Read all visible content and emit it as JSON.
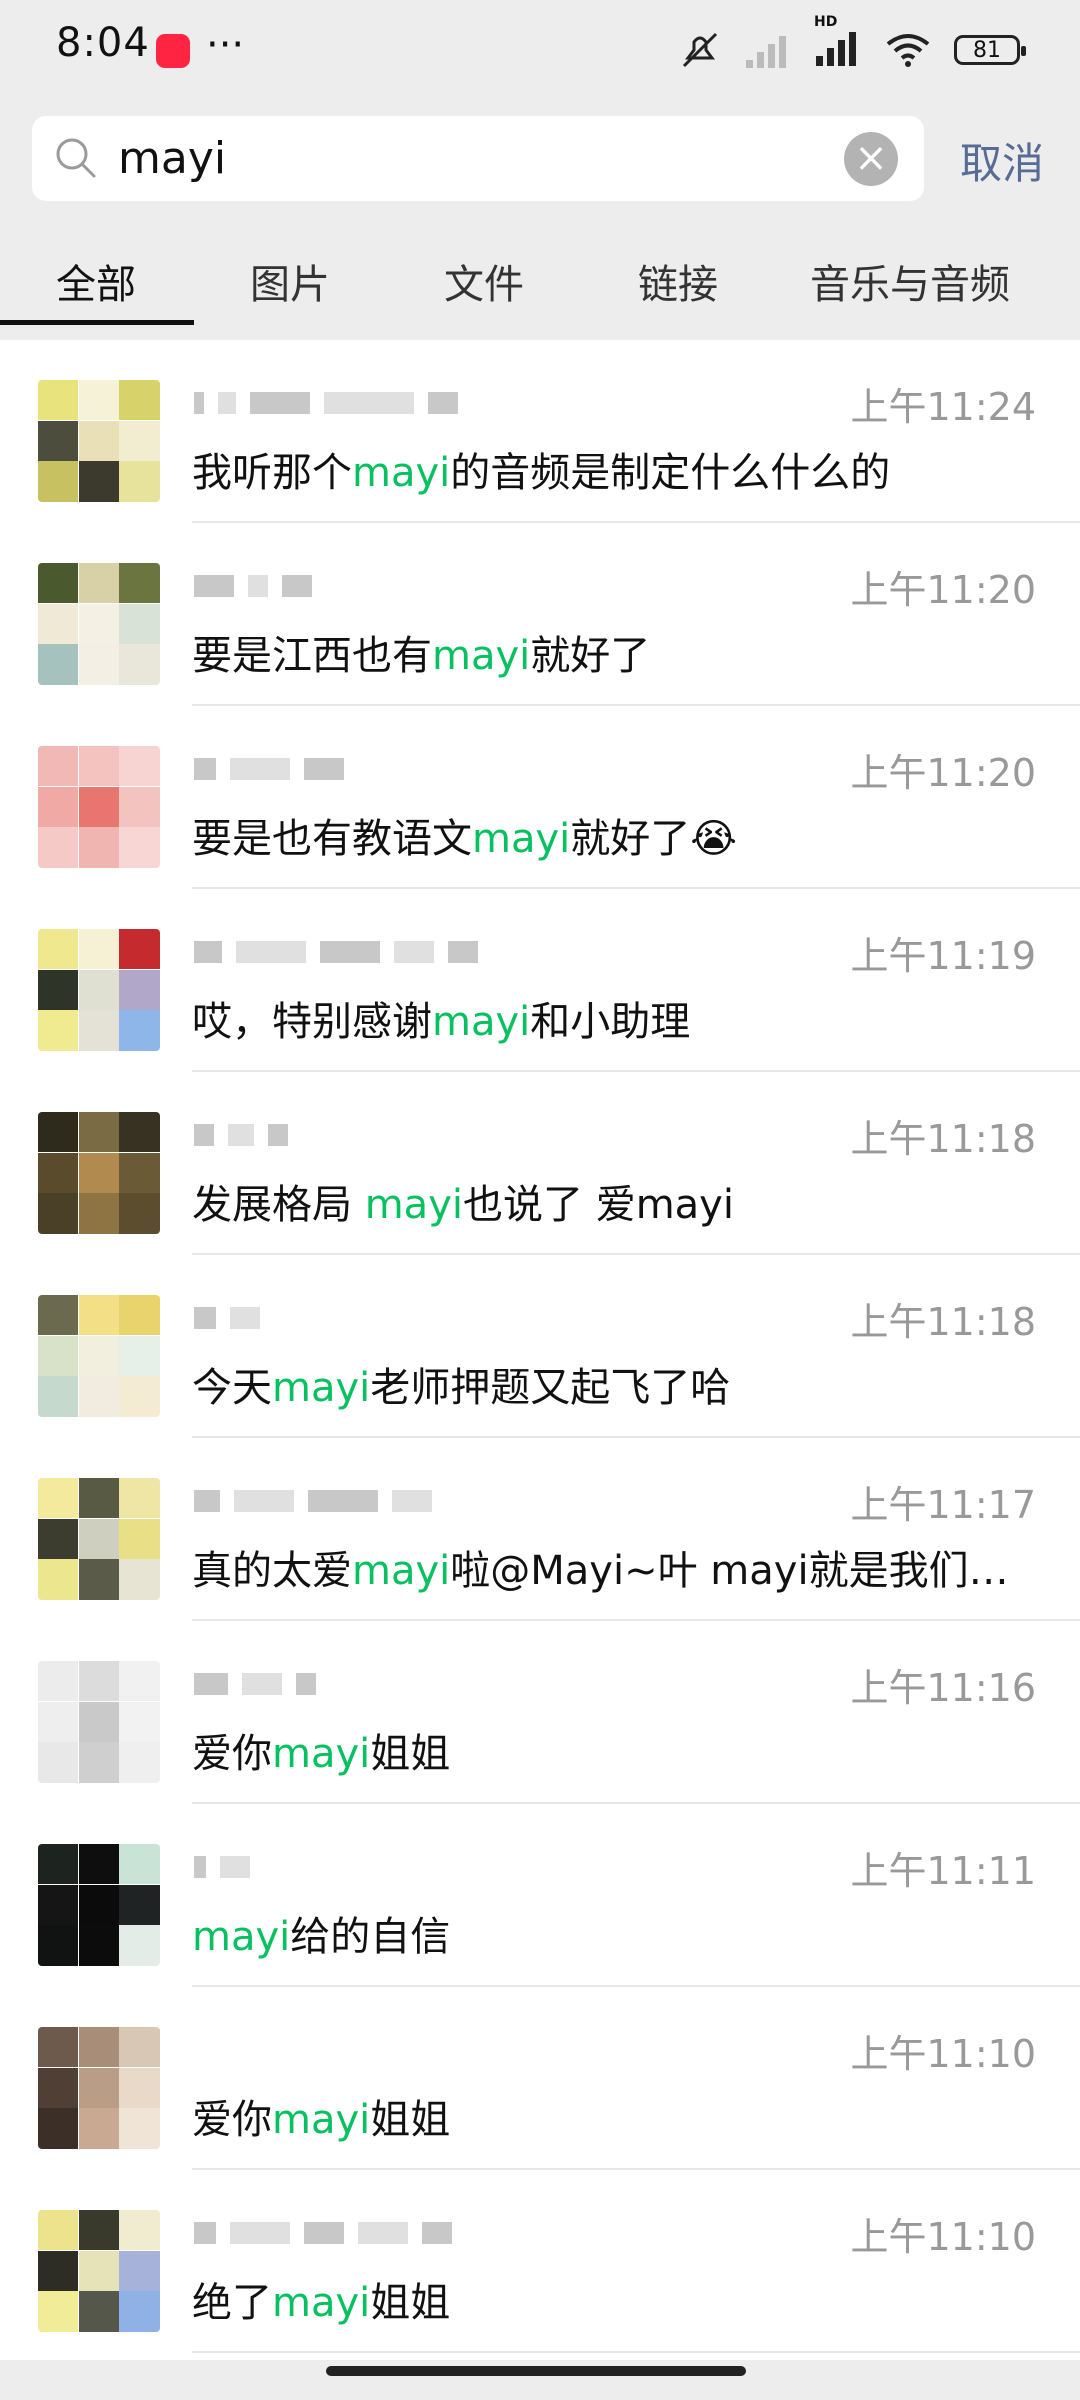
{
  "status_bar": {
    "time": "8:04",
    "notification_app_label": "小红书",
    "more": "···",
    "battery": "81",
    "network": "HD"
  },
  "search": {
    "query": "mayi",
    "cancel_label": "取消"
  },
  "tabs": [
    {
      "label": "全部",
      "active": true
    },
    {
      "label": "图片",
      "active": false
    },
    {
      "label": "文件",
      "active": false
    },
    {
      "label": "链接",
      "active": false
    },
    {
      "label": "音乐与音频",
      "active": false
    }
  ],
  "results": [
    {
      "time": "上午11:24",
      "parts": [
        "我听那个",
        "mayi",
        "的音频是制定什么什么的"
      ],
      "avatar": [
        "#e9e37e",
        "#f6f2d8",
        "#d8d26b",
        "#4d4d3e",
        "#e9e0b8",
        "#f2ecd0",
        "#c7c162",
        "#3b3a2c",
        "#e8e39c"
      ]
    },
    {
      "time": "上午11:20",
      "parts": [
        "要是江西也有",
        "mayi",
        "就好了"
      ],
      "avatar": [
        "#4b5a2e",
        "#d8d1a7",
        "#6a7540",
        "#efe9d6",
        "#f4f1e4",
        "#d9e2d6",
        "#a6c2bf",
        "#f3efe5",
        "#e9e6da"
      ]
    },
    {
      "time": "上午11:20",
      "parts": [
        "要是也有教语文",
        "mayi",
        "就好了😭"
      ],
      "avatar": [
        "#f2b8b5",
        "#f4c2bf",
        "#f7d3d1",
        "#f0a9a4",
        "#e9766e",
        "#f3c3c0",
        "#f5c9c6",
        "#f1b5b1",
        "#f8d6d4"
      ]
    },
    {
      "time": "上午11:19",
      "parts": [
        "哎，特别感谢",
        "mayi",
        "和小助理"
      ],
      "avatar": [
        "#f0e88e",
        "#f6f1d4",
        "#c42a2e",
        "#2f3428",
        "#dfe0d2",
        "#b0a7c9",
        "#f0ea90",
        "#e4e2d6",
        "#8fb6e8"
      ]
    },
    {
      "time": "上午11:18",
      "parts": [
        "发展格局 ",
        "mayi",
        "也说了 爱mayi"
      ],
      "avatar": [
        "#2e2a1c",
        "#7b6b45",
        "#383222",
        "#5a4b2d",
        "#b08a4e",
        "#6b5a36",
        "#4a3f27",
        "#8e7443",
        "#5c4d2e"
      ]
    },
    {
      "time": "上午11:18",
      "parts": [
        "今天",
        "mayi",
        "老师押题又起飞了哈"
      ],
      "avatar": [
        "#6b6a4e",
        "#f2df86",
        "#e9d36c",
        "#d8e2c8",
        "#f3efdf",
        "#e6f0e8",
        "#c6d9cd",
        "#f1ebe0",
        "#f4ecd2"
      ]
    },
    {
      "time": "上午11:17",
      "parts": [
        "真的太爱",
        "mayi",
        "啦@Mayi~叶 mayi就是我们…"
      ],
      "avatar": [
        "#f3ea9e",
        "#595a44",
        "#efe6a5",
        "#3d3d2f",
        "#cfcfbf",
        "#e9df86",
        "#ece68f",
        "#5a5b48",
        "#e7e4d4"
      ]
    },
    {
      "time": "上午11:16",
      "parts": [
        "爱你",
        "mayi",
        "姐姐"
      ],
      "avatar": [
        "#ececec",
        "#dcdcdc",
        "#f1f1f1",
        "#eeeeee",
        "#c9c9c9",
        "#f2f2f2",
        "#e8e8e8",
        "#cfcfcf",
        "#efefef"
      ]
    },
    {
      "time": "上午11:11",
      "parts": [
        "",
        "mayi",
        "给的自信"
      ],
      "avatar": [
        "#1d2420",
        "#0e0e0e",
        "#c9e3d7",
        "#151515",
        "#0b0b0b",
        "#202323",
        "#101312",
        "#0c0c0c",
        "#e4ece8"
      ]
    },
    {
      "time": "上午11:10",
      "parts": [
        "爱你",
        "mayi",
        "姐姐"
      ],
      "avatar": [
        "#6e5a4c",
        "#a88d79",
        "#d9c7b5",
        "#4f3f35",
        "#b99d87",
        "#e8d9c8",
        "#3c2f28",
        "#caa993",
        "#f0e4d7"
      ]
    },
    {
      "time": "上午11:10",
      "parts": [
        "绝了",
        "mayi",
        "姐姐"
      ],
      "avatar": [
        "#ece38c",
        "#3a3a2c",
        "#f1ecd0",
        "#2d2d25",
        "#e6e3b9",
        "#a7b2da",
        "#f1ec98",
        "#55574a",
        "#8fb1e6"
      ]
    }
  ]
}
